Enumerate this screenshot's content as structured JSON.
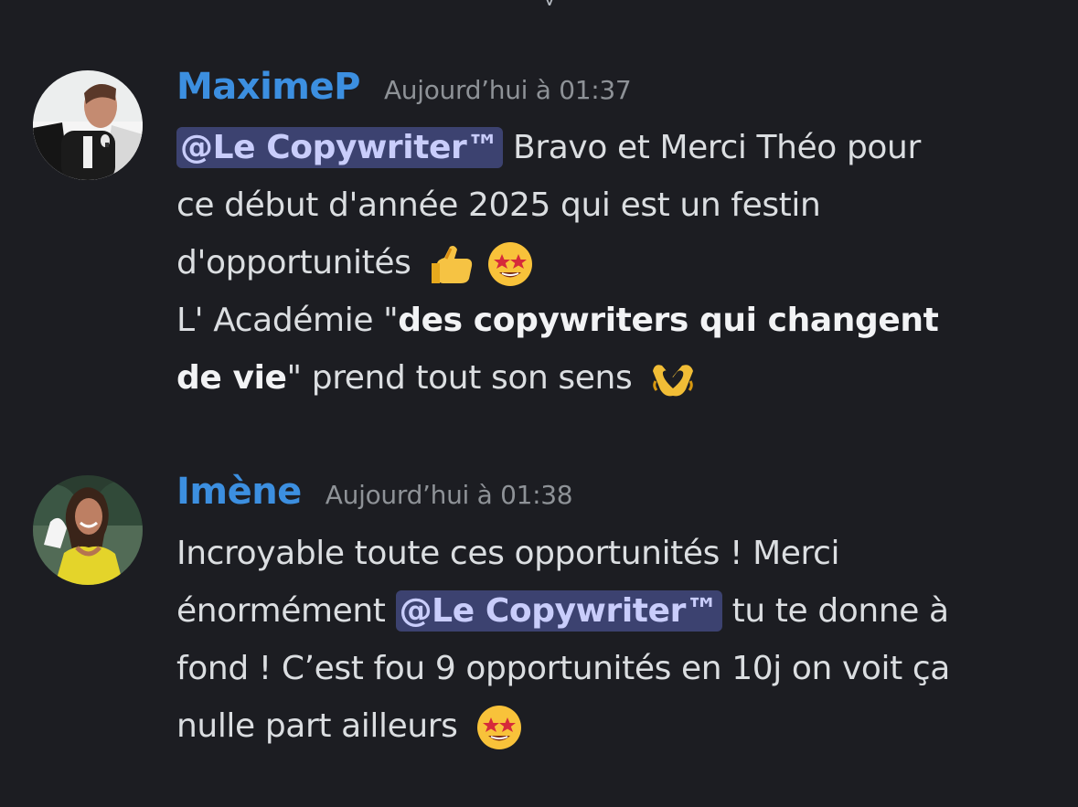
{
  "top_fragment": "y",
  "messages": [
    {
      "author": "MaximeP",
      "timestamp": "Aujourd’hui à 01:37",
      "lines": [
        {
          "mention": "@Le Copywriter™",
          "text": " Bravo et Merci Théo pour"
        },
        {
          "text": "ce début d'année 2025 qui est un festin"
        },
        {
          "text": "d'opportunités ",
          "emoji_1": "thumbs-up-icon",
          "emoji_2": "star-struck-icon"
        },
        {
          "prefix": "L' Académie \"",
          "bold": "des copywriters qui changent"
        },
        {
          "bold": "de vie",
          "suffix": "\" prend tout son sens ",
          "emoji": "heart-hands-icon"
        }
      ]
    },
    {
      "author": "Imène",
      "timestamp": "Aujourd’hui à 01:38",
      "lines": [
        {
          "text": "Incroyable toute ces opportunités ! Merci"
        },
        {
          "prefix": "énormément ",
          "mention": "@Le Copywriter™",
          "suffix": " tu te donne à"
        },
        {
          "text": "fond ! C’est fou 9 opportunités en 10j on voit ça"
        },
        {
          "text": "nulle part ailleurs ",
          "emoji": "star-struck-icon"
        }
      ]
    }
  ],
  "colors": {
    "background": "#1c1d22",
    "author_name": "#3c8fe0",
    "timestamp": "#8e9297",
    "message_text": "#dbdee1",
    "mention_background": "#3c4270",
    "mention_text": "#c9cdfb"
  }
}
